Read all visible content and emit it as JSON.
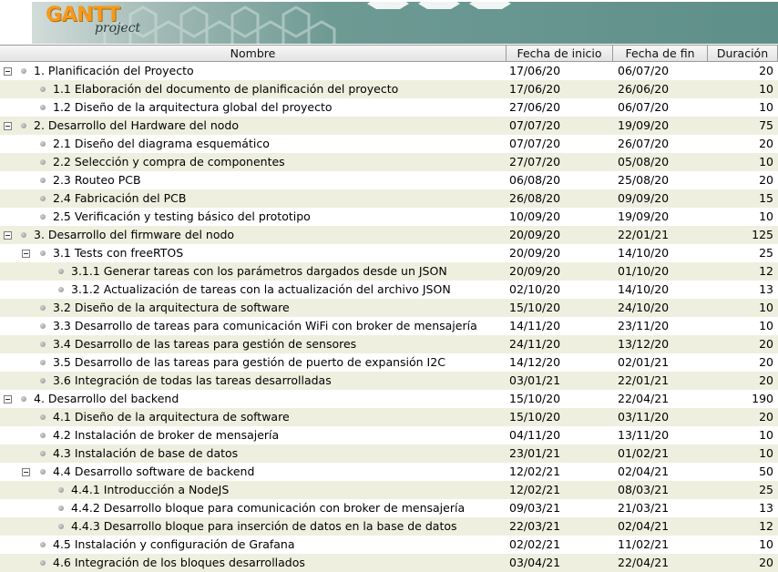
{
  "logo": {
    "brand": "GANTT",
    "sub": "project"
  },
  "columns": {
    "name": "Nombre",
    "start": "Fecha de inicio",
    "end": "Fecha de fin",
    "duration": "Duración"
  },
  "tasks": [
    {
      "level": 0,
      "expandable": true,
      "name": "1. Planificación del Proyecto",
      "start": "17/06/20",
      "end": "06/07/20",
      "duration": "20"
    },
    {
      "level": 1,
      "expandable": false,
      "name": "1.1 Elaboración del documento de planificación del proyecto",
      "start": "17/06/20",
      "end": "26/06/20",
      "duration": "10"
    },
    {
      "level": 1,
      "expandable": false,
      "name": "1.2 Diseño de la arquitectura global del proyecto",
      "start": "27/06/20",
      "end": "06/07/20",
      "duration": "10"
    },
    {
      "level": 0,
      "expandable": true,
      "name": "2. Desarrollo del Hardware del nodo",
      "start": "07/07/20",
      "end": "19/09/20",
      "duration": "75"
    },
    {
      "level": 1,
      "expandable": false,
      "name": "2.1 Diseño del diagrama esquemático",
      "start": "07/07/20",
      "end": "26/07/20",
      "duration": "20"
    },
    {
      "level": 1,
      "expandable": false,
      "name": "2.2 Selección y compra de componentes",
      "start": "27/07/20",
      "end": "05/08/20",
      "duration": "10"
    },
    {
      "level": 1,
      "expandable": false,
      "name": "2.3 Routeo PCB",
      "start": "06/08/20",
      "end": "25/08/20",
      "duration": "20"
    },
    {
      "level": 1,
      "expandable": false,
      "name": "2.4 Fabricación del PCB",
      "start": "26/08/20",
      "end": "09/09/20",
      "duration": "15"
    },
    {
      "level": 1,
      "expandable": false,
      "name": "2.5 Verificación y testing básico del prototipo",
      "start": "10/09/20",
      "end": "19/09/20",
      "duration": "10"
    },
    {
      "level": 0,
      "expandable": true,
      "name": "3. Desarrollo del firmware del nodo",
      "start": "20/09/20",
      "end": "22/01/21",
      "duration": "125"
    },
    {
      "level": 1,
      "expandable": true,
      "name": "3.1 Tests con freeRTOS",
      "start": "20/09/20",
      "end": "14/10/20",
      "duration": "25"
    },
    {
      "level": 2,
      "expandable": false,
      "name": "3.1.1 Generar tareas con los parámetros dargados desde un JSON",
      "start": "20/09/20",
      "end": "01/10/20",
      "duration": "12"
    },
    {
      "level": 2,
      "expandable": false,
      "name": "3.1.2 Actualización de tareas con la actualización del archivo JSON",
      "start": "02/10/20",
      "end": "14/10/20",
      "duration": "13"
    },
    {
      "level": 1,
      "expandable": false,
      "name": "3.2 Diseño de la arquitectura de software",
      "start": "15/10/20",
      "end": "24/10/20",
      "duration": "10"
    },
    {
      "level": 1,
      "expandable": false,
      "name": "3.3 Desarrollo de tareas para comunicación WiFi con broker de mensajería",
      "start": "14/11/20",
      "end": "23/11/20",
      "duration": "10"
    },
    {
      "level": 1,
      "expandable": false,
      "name": "3.4 Desarrollo de las tareas para gestión de sensores",
      "start": "24/11/20",
      "end": "13/12/20",
      "duration": "20"
    },
    {
      "level": 1,
      "expandable": false,
      "name": "3.5 Desarrollo de las tareas para gestión de puerto de expansión I2C",
      "start": "14/12/20",
      "end": "02/01/21",
      "duration": "20"
    },
    {
      "level": 1,
      "expandable": false,
      "name": "3.6 Integración de todas las tareas desarrolladas",
      "start": "03/01/21",
      "end": "22/01/21",
      "duration": "20"
    },
    {
      "level": 0,
      "expandable": true,
      "name": "4. Desarrollo del backend",
      "start": "15/10/20",
      "end": "22/04/21",
      "duration": "190"
    },
    {
      "level": 1,
      "expandable": false,
      "name": "4.1 Diseño de la arquitectura de software",
      "start": "15/10/20",
      "end": "03/11/20",
      "duration": "20"
    },
    {
      "level": 1,
      "expandable": false,
      "name": "4.2 Instalación de broker de mensajería",
      "start": "04/11/20",
      "end": "13/11/20",
      "duration": "10"
    },
    {
      "level": 1,
      "expandable": false,
      "name": "4.3 Instalación de base de datos",
      "start": "23/01/21",
      "end": "01/02/21",
      "duration": "10"
    },
    {
      "level": 1,
      "expandable": true,
      "name": "4.4 Desarrollo software de backend",
      "start": "12/02/21",
      "end": "02/04/21",
      "duration": "50"
    },
    {
      "level": 2,
      "expandable": false,
      "name": "4.4.1 Introducción a NodeJS",
      "start": "12/02/21",
      "end": "08/03/21",
      "duration": "25"
    },
    {
      "level": 2,
      "expandable": false,
      "name": "4.4.2 Desarrollo bloque para comunicación con broker de mensajería",
      "start": "09/03/21",
      "end": "21/03/21",
      "duration": "13"
    },
    {
      "level": 2,
      "expandable": false,
      "name": "4.4.3 Desarrollo bloque para inserción de datos en la base de datos",
      "start": "22/03/21",
      "end": "02/04/21",
      "duration": "12"
    },
    {
      "level": 1,
      "expandable": false,
      "name": "4.5 Instalación y configuración de Grafana",
      "start": "02/02/21",
      "end": "11/02/21",
      "duration": "10"
    },
    {
      "level": 1,
      "expandable": false,
      "name": "4.6 Integración de los bloques desarrollados",
      "start": "03/04/21",
      "end": "22/04/21",
      "duration": "20"
    }
  ]
}
